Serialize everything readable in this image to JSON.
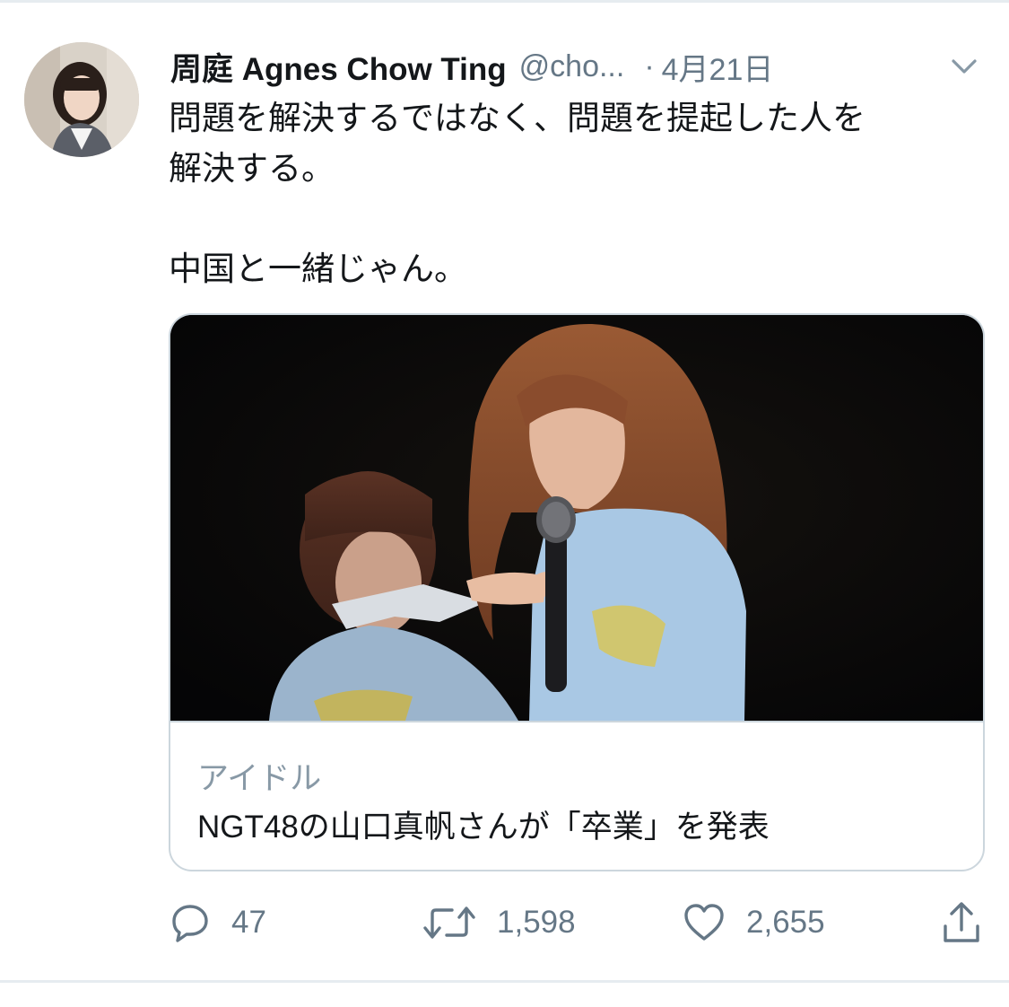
{
  "tweet": {
    "author_name": "周庭 Agnes Chow Ting",
    "handle": "@cho...",
    "separator": "·",
    "date": "4月21日",
    "text_line1": "問題を解決するではなく、問題を提起した人を",
    "text_line2": "解決する。",
    "text_line3": "中国と一緒じゃん。"
  },
  "card": {
    "domain_label": "アイドル",
    "title": "NGT48の山口真帆さんが「卒業」を発表"
  },
  "actions": {
    "replies": "47",
    "retweets": "1,598",
    "likes": "2,655"
  },
  "icons": {
    "reply": "speech-bubble",
    "retweet": "retweet-arrows",
    "like": "heart",
    "share": "share-upload",
    "menu": "chevron-down"
  },
  "colors": {
    "text": "#14171a",
    "secondary": "#657786",
    "border": "#ccd6dd"
  }
}
